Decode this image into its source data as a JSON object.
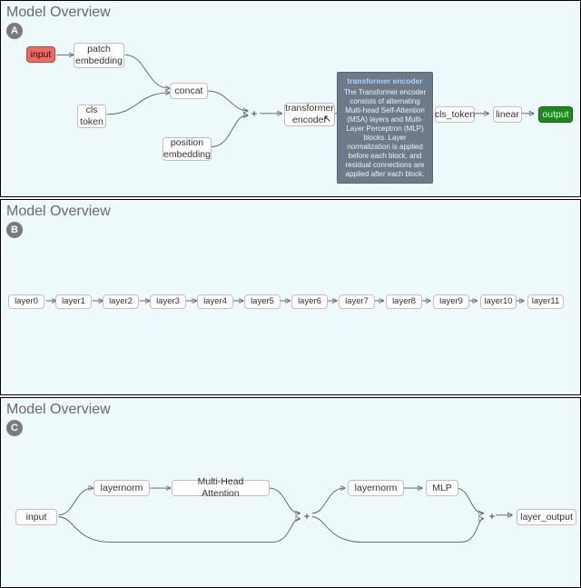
{
  "panelA": {
    "title": "Model Overview",
    "badge": "A",
    "nodes": {
      "input": "input",
      "patch_embedding": "patch\nembedding",
      "concat": "concat",
      "cls_token_in": "cls\ntoken",
      "position_embedding": "position\nembedding",
      "plus1": "+",
      "transformer_encoder": "transformer\nencoder",
      "cls_token_out": "cls_token",
      "linear": "linear",
      "output": "output"
    },
    "tooltip": {
      "title": "transformer encoder",
      "body": "The Transformer encoder consists of alternating Multi-head Self-Attention (MSA) layers and Multi-Layer Perceptron (MLP) blocks. Layer normalization is applied before each block, and residual connections are applied after each block."
    }
  },
  "panelB": {
    "title": "Model Overview",
    "badge": "B",
    "layers": [
      "layer0",
      "layer1",
      "layer2",
      "layer3",
      "layer4",
      "layer5",
      "layer6",
      "layer7",
      "layer8",
      "layer9",
      "layer10",
      "layer11"
    ]
  },
  "panelC": {
    "title": "Model Overview",
    "badge": "C",
    "nodes": {
      "input": "input",
      "layernorm1": "layernorm",
      "mha": "Multi-Head Attention",
      "plus1": "+",
      "layernorm2": "layernorm",
      "mlp": "MLP",
      "plus2": "+",
      "layer_output": "layer_output"
    }
  }
}
